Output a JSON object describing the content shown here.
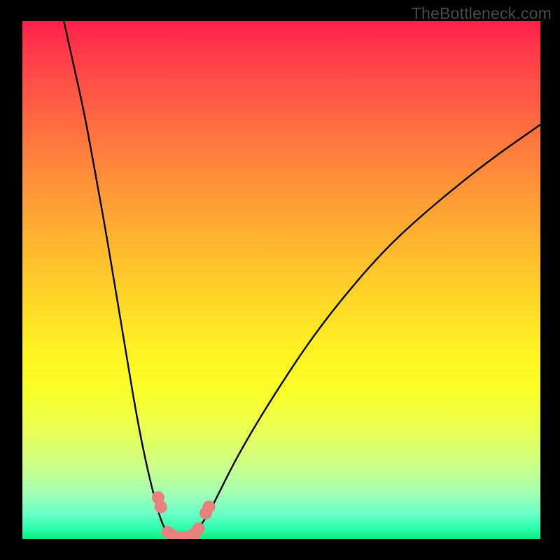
{
  "watermark": "TheBottleneck.com",
  "chart_data": {
    "type": "line",
    "title": "",
    "xlabel": "",
    "ylabel": "",
    "xlim": [
      0,
      100
    ],
    "ylim": [
      0,
      100
    ],
    "series": [
      {
        "name": "curve-left",
        "x": [
          8,
          10,
          12,
          14,
          16,
          18,
          20,
          22,
          24,
          26,
          27,
          28,
          29
        ],
        "y": [
          100,
          91,
          82,
          71,
          60,
          48,
          36,
          24,
          14,
          6,
          3,
          1,
          0
        ]
      },
      {
        "name": "curve-right",
        "x": [
          33,
          34,
          36,
          38,
          41,
          45,
          50,
          56,
          63,
          71,
          80,
          90,
          100
        ],
        "y": [
          0,
          2,
          5,
          9,
          15,
          22,
          30,
          39,
          48,
          57,
          65,
          73,
          80
        ]
      },
      {
        "name": "valley-floor",
        "x": [
          29,
          30,
          31,
          32,
          33
        ],
        "y": [
          0,
          0,
          0,
          0,
          0
        ]
      }
    ],
    "markers": [
      {
        "cluster": "left-upper",
        "x": 26.2,
        "y": 8.0
      },
      {
        "cluster": "left-upper",
        "x": 26.7,
        "y": 6.2
      },
      {
        "cluster": "left-lower",
        "x": 28.1,
        "y": 1.3
      },
      {
        "cluster": "left-lower",
        "x": 29.3,
        "y": 0.5
      },
      {
        "cluster": "floor",
        "x": 30.5,
        "y": 0.3
      },
      {
        "cluster": "floor",
        "x": 31.6,
        "y": 0.3
      },
      {
        "cluster": "floor",
        "x": 32.5,
        "y": 0.5
      },
      {
        "cluster": "right-lower",
        "x": 33.3,
        "y": 1.0
      },
      {
        "cluster": "right-lower",
        "x": 34.0,
        "y": 2.0
      },
      {
        "cluster": "right-upper",
        "x": 35.4,
        "y": 5.0
      },
      {
        "cluster": "right-upper",
        "x": 36.0,
        "y": 6.2
      }
    ],
    "marker_color": "#e6817f",
    "marker_radius": 9
  }
}
